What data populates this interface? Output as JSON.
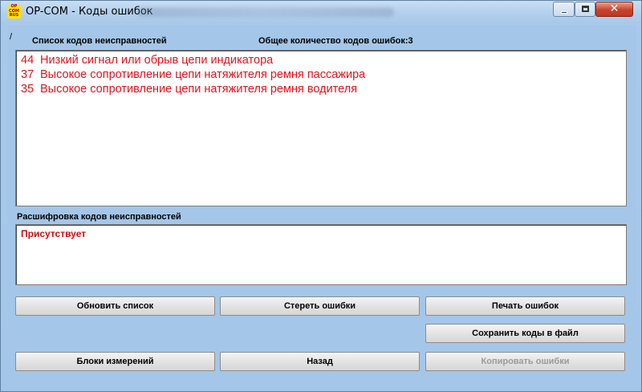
{
  "window": {
    "title": "OP-COM - Коды ошибок",
    "icon_text": "OP COM RUS"
  },
  "header": {
    "slash": "/",
    "list_label": "Список кодов неисправностей",
    "count_label": "Общее количество кодов ошибок:3"
  },
  "faults": [
    {
      "code": "44",
      "text": "Низкий сигнал или обрыв цепи индикатора"
    },
    {
      "code": "37",
      "text": "Высокое сопротивление цепи натяжителя ремня пассажира"
    },
    {
      "code": "35",
      "text": "Высокое сопротивление цепи натяжителя ремня водителя"
    }
  ],
  "decode": {
    "label": "Расшифровка кодов неисправностей",
    "text": "Присутствует"
  },
  "buttons": {
    "refresh": "Обновить список",
    "clear": "Стереть ошибки",
    "print": "Печать ошибок",
    "save": "Сохранить коды в файл",
    "blocks": "Блоки измерений",
    "back": "Назад",
    "copy": "Копировать ошибки"
  },
  "colors": {
    "fault_text": "#e0141c",
    "window_bg": "#a4c6e8",
    "close_button": "#c7432b"
  }
}
